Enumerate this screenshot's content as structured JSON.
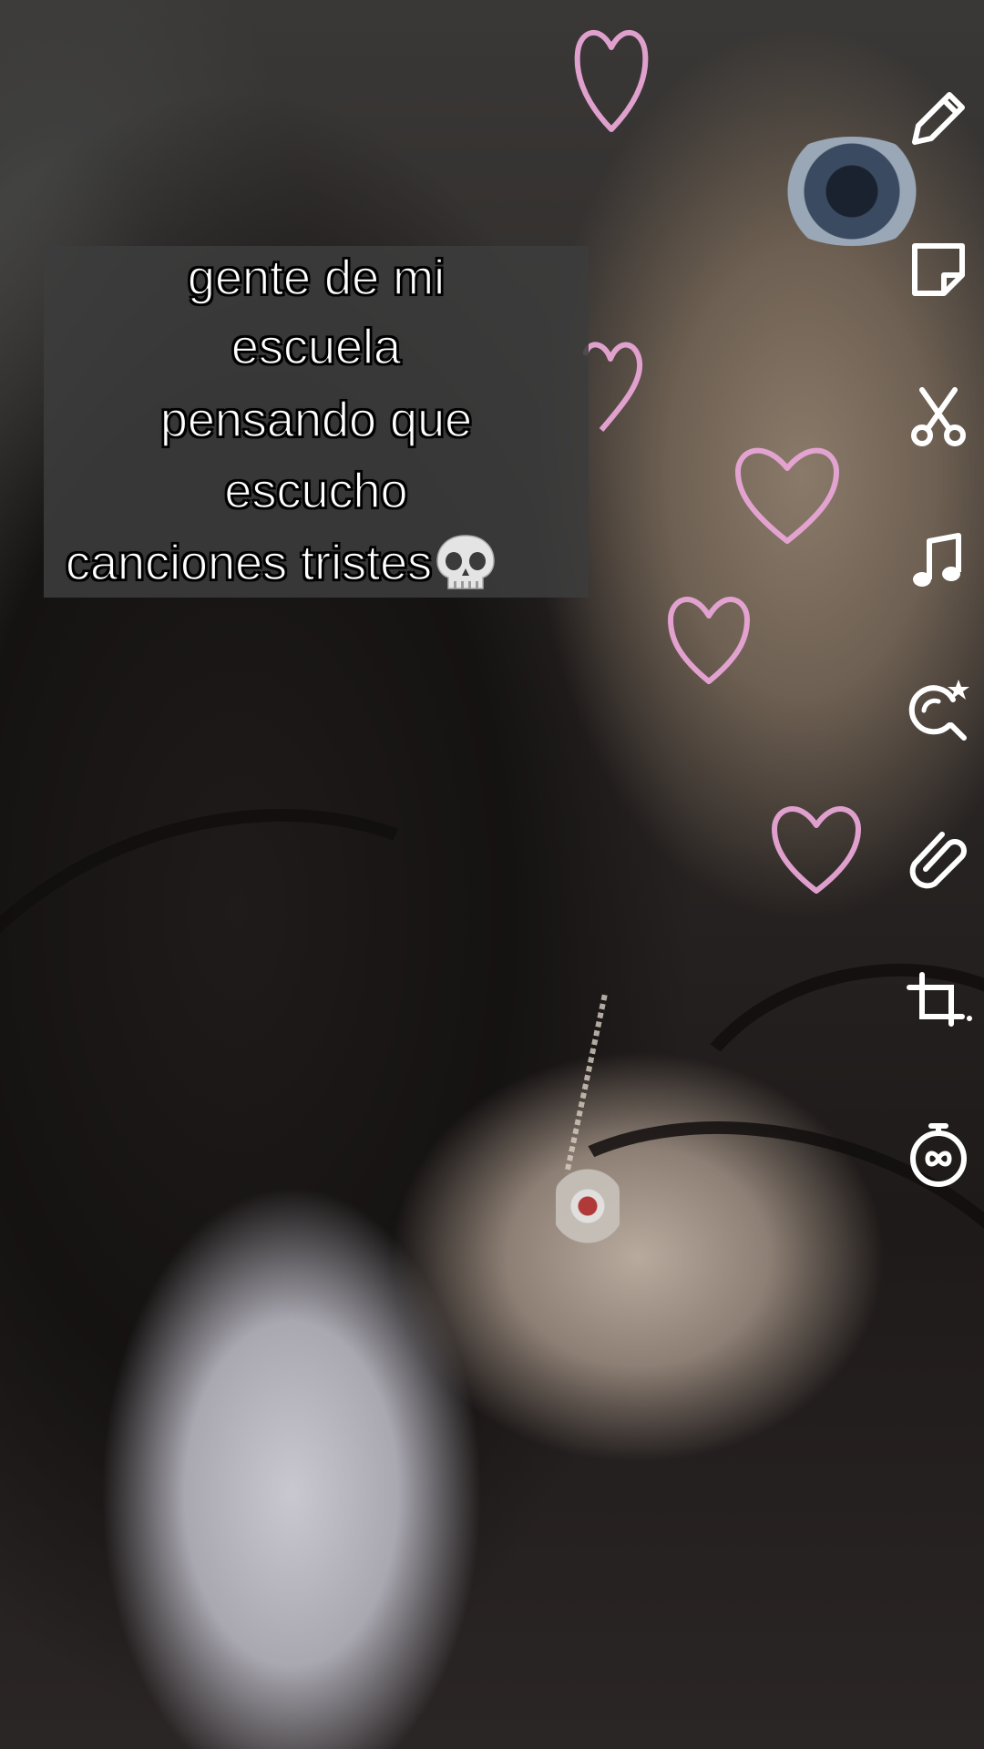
{
  "caption": {
    "lines": [
      "gente de mi",
      "escuela",
      "pensando que",
      "escucho",
      "canciones tristes"
    ],
    "emoji": "skull-emoji"
  },
  "toolbar": {
    "tools": [
      {
        "name": "pencil-icon",
        "label": "draw"
      },
      {
        "name": "sticker-icon",
        "label": "stickers"
      },
      {
        "name": "scissors-icon",
        "label": "cut"
      },
      {
        "name": "music-note-icon",
        "label": "music"
      },
      {
        "name": "lens-icon",
        "label": "lenses"
      },
      {
        "name": "paperclip-icon",
        "label": "link"
      },
      {
        "name": "crop-icon",
        "label": "crop"
      },
      {
        "name": "timer-icon",
        "label": "timer"
      }
    ]
  },
  "colors": {
    "heart_stroke": "#e9a6d6",
    "caption_bg": "#3c3c3c",
    "caption_text": "#ffffff",
    "icon_color": "#ffffff"
  }
}
